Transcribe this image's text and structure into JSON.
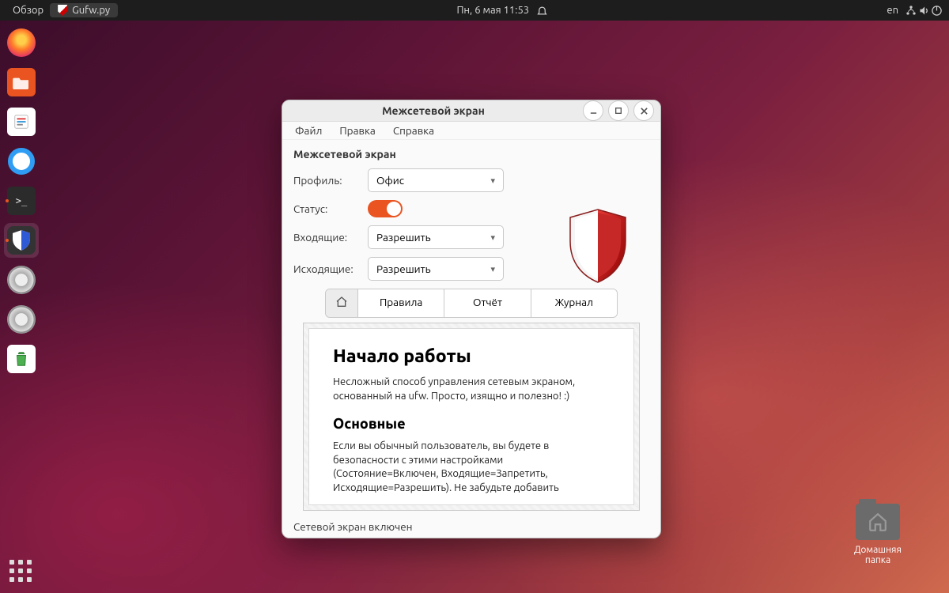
{
  "topbar": {
    "overview": "Обзор",
    "app_task": "Gufw.py",
    "datetime": "Пн, 6 мая  11:53",
    "lang": "en"
  },
  "desktop": {
    "home_folder": "Домашняя папка"
  },
  "window": {
    "title": "Межсетевой экран",
    "menu": {
      "file": "Файл",
      "edit": "Правка",
      "help": "Справка"
    },
    "section": "Межсетевой экран",
    "labels": {
      "profile": "Профиль:",
      "status": "Статус:",
      "incoming": "Входящие:",
      "outgoing": "Исходящие:"
    },
    "values": {
      "profile": "Офис",
      "incoming": "Разрешить",
      "outgoing": "Разрешить"
    },
    "tabs": {
      "rules": "Правила",
      "report": "Отчёт",
      "log": "Журнал"
    },
    "doc": {
      "h1": "Начало работы",
      "p1": "Несложный способ управления сетевым экраном, основанный на ufw. Просто, изящно и полезно! :)",
      "h2": "Основные",
      "p2": "Если вы обычный пользователь, вы будете в безопасности с этими настройками (Состояние=Включен, Входящие=Запретить, Исходящие=Разрешить). Не забудьте добавить"
    },
    "statusbar": "Сетевой экран включен"
  }
}
